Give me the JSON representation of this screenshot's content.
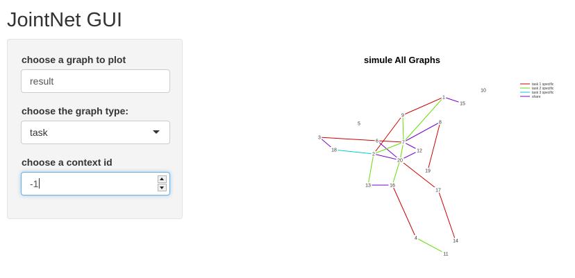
{
  "app": {
    "title": "JointNet GUI"
  },
  "sidebar": {
    "graph_label": "choose a graph to plot",
    "graph_value": "result",
    "type_label": "choose the graph type:",
    "type_value": "task",
    "context_label": "choose a context id",
    "context_value": "-1"
  },
  "plot": {
    "title": "simule All Graphs",
    "legend": [
      {
        "label": "task 1 specific",
        "color": "#cc0000"
      },
      {
        "label": "task 2 specific",
        "color": "#66dd00"
      },
      {
        "label": "task 3 specific",
        "color": "#00cccc"
      },
      {
        "label": "share",
        "color": "#7700cc"
      }
    ],
    "nodes": [
      {
        "id": "1"
      },
      {
        "id": "2"
      },
      {
        "id": "3"
      },
      {
        "id": "4"
      },
      {
        "id": "5"
      },
      {
        "id": "6"
      },
      {
        "id": "7"
      },
      {
        "id": "8"
      },
      {
        "id": "9"
      },
      {
        "id": "10"
      },
      {
        "id": "11"
      },
      {
        "id": "12"
      },
      {
        "id": "13"
      },
      {
        "id": "14"
      },
      {
        "id": "15"
      },
      {
        "id": "16"
      },
      {
        "id": "17"
      },
      {
        "id": "18"
      },
      {
        "id": "19"
      },
      {
        "id": "20"
      }
    ],
    "edges": [
      {
        "from": "9",
        "to": "1",
        "group": "task 1 specific"
      },
      {
        "from": "1",
        "to": "15",
        "group": "share"
      },
      {
        "from": "1",
        "to": "7",
        "group": "task 2 specific"
      },
      {
        "from": "9",
        "to": "7",
        "group": "task 2 specific"
      },
      {
        "from": "9",
        "to": "2",
        "group": "task 1 specific"
      },
      {
        "from": "8",
        "to": "7",
        "group": "share"
      },
      {
        "from": "8",
        "to": "19",
        "group": "task 1 specific"
      },
      {
        "from": "3",
        "to": "6",
        "group": "task 1 specific"
      },
      {
        "from": "3",
        "to": "18",
        "group": "share"
      },
      {
        "from": "18",
        "to": "2",
        "group": "task 3 specific"
      },
      {
        "from": "6",
        "to": "7",
        "group": "task 1 specific"
      },
      {
        "from": "6",
        "to": "20",
        "group": "share"
      },
      {
        "from": "2",
        "to": "7",
        "group": "task 2 specific"
      },
      {
        "from": "2",
        "to": "20",
        "group": "share"
      },
      {
        "from": "2",
        "to": "13",
        "group": "task 2 specific"
      },
      {
        "from": "7",
        "to": "12",
        "group": "share"
      },
      {
        "from": "7",
        "to": "20",
        "group": "task 2 specific"
      },
      {
        "from": "12",
        "to": "20",
        "group": "share"
      },
      {
        "from": "20",
        "to": "16",
        "group": "task 2 specific"
      },
      {
        "from": "20",
        "to": "17",
        "group": "task 1 specific"
      },
      {
        "from": "13",
        "to": "16",
        "group": "share"
      },
      {
        "from": "16",
        "to": "4",
        "group": "task 1 specific"
      },
      {
        "from": "17",
        "to": "14",
        "group": "task 1 specific"
      },
      {
        "from": "4",
        "to": "11",
        "group": "task 2 specific"
      }
    ]
  }
}
